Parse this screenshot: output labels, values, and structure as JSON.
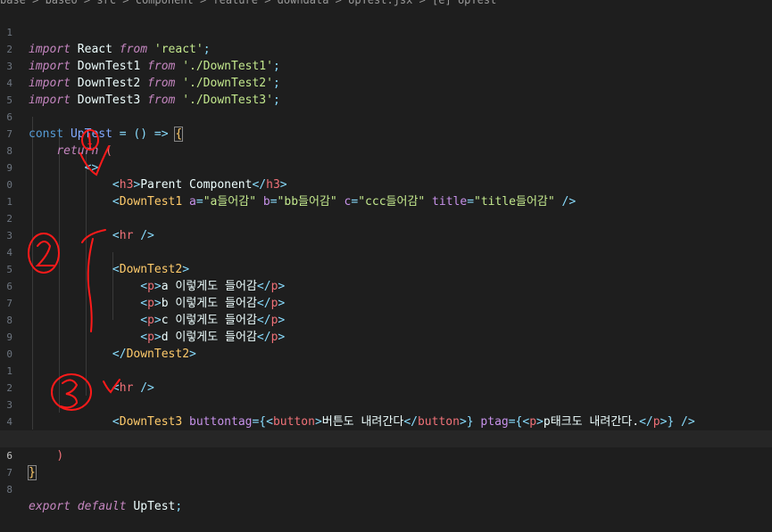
{
  "breadcrumb": "base > baseo > src > component > feature > downdata > UpTest.jsx > [e] UpTest",
  "line_numbers": [
    "1",
    "2",
    "3",
    "4",
    "5",
    "6",
    "7",
    "8",
    "9",
    "0",
    "1",
    "2",
    "3",
    "4",
    "5",
    "6",
    "7",
    "8",
    "9",
    "0",
    "1",
    "2",
    "3",
    "4",
    "5",
    "6",
    "7",
    "8"
  ],
  "code": {
    "l1": {
      "kw": "import",
      "name": " React ",
      "from": "from",
      "space": " ",
      "str": "'react'",
      "end": ";"
    },
    "l2": {
      "kw": "import",
      "name": " DownTest1 ",
      "from": "from",
      "space": " ",
      "str": "'./DownTest1'",
      "end": ";"
    },
    "l3": {
      "kw": "import",
      "name": " DownTest2 ",
      "from": "from",
      "space": " ",
      "str": "'./DownTest2'",
      "end": ";"
    },
    "l4": {
      "kw": "import",
      "name": " DownTest3 ",
      "from": "from",
      "space": " ",
      "str": "'./DownTest3'",
      "end": ";"
    },
    "l6": {
      "const": "const",
      "name": " UpTest",
      "eq": " = () => ",
      "brace": "{"
    },
    "l7": {
      "ret": "return",
      "paren": " ("
    },
    "l8": {
      "frag": "<>"
    },
    "l9": {
      "open": "<",
      "tag": "h3",
      "close": ">",
      "text": "Parent Component",
      "end_open": "</",
      "end_tag": "h3",
      "end_close": ">"
    },
    "l10": {
      "open": "<",
      "comp": "DownTest1",
      "a": " a",
      "eq1": "=",
      "v1": "\"a들어감\"",
      "b": " b",
      "eq2": "=",
      "v2": "\"bb들어감\"",
      "c": " c",
      "eq3": "=",
      "v3": "\"ccc들어감\"",
      "t": " title",
      "eq4": "=",
      "v4": "\"title들어감\"",
      "close": " />"
    },
    "l12": {
      "open": "<",
      "tag": "hr",
      "close": " />"
    },
    "l14": {
      "open": "<",
      "comp": "DownTest2",
      "close": ">"
    },
    "p_lines": [
      {
        "open": "<",
        "tag": "p",
        "close": ">",
        "text": "a 이렇게도 들어감",
        "end_open": "</",
        "end_tag": "p",
        "end_close": ">"
      },
      {
        "open": "<",
        "tag": "p",
        "close": ">",
        "text": "b 이렇게도 들어감",
        "end_open": "</",
        "end_tag": "p",
        "end_close": ">"
      },
      {
        "open": "<",
        "tag": "p",
        "close": ">",
        "text": "c 이렇게도 들어감",
        "end_open": "</",
        "end_tag": "p",
        "end_close": ">"
      },
      {
        "open": "<",
        "tag": "p",
        "close": ">",
        "text": "d 이렇게도 들어감",
        "end_open": "</",
        "end_tag": "p",
        "end_close": ">"
      }
    ],
    "l19": {
      "open": "</",
      "comp": "DownTest2",
      "close": ">"
    },
    "l21": {
      "open": "<",
      "tag": "hr",
      "close": " />"
    },
    "l23": {
      "open": "<",
      "comp": "DownTest3",
      "a1": " buttontag",
      "eq1": "={",
      "bo": "<",
      "bt": "button",
      "bc": ">",
      "btext": "버튼도 내려간다",
      "beo": "</",
      "bet": "button",
      "bec": ">",
      "b_end": "}",
      "a2": " ptag",
      "eq2": "={",
      "po": "<",
      "pt": "p",
      "pc": ">",
      "ptext": "p태크도 내려간다.",
      "peo": "</",
      "pet": "p",
      "pec": ">",
      "p_end": "}",
      "close": " />"
    },
    "l24": {
      "frag": "</>"
    },
    "l25": {
      "paren": ")"
    },
    "l26": {
      "brace": "}"
    },
    "l28": {
      "export": "export",
      "def": " default",
      "name": " UpTest",
      "end": ";"
    }
  },
  "annotations": [
    "1",
    "2",
    "3"
  ],
  "colors": {
    "background": "#1e1e1e",
    "keyword": "#c586c0",
    "string": "#c3e88d",
    "tag": "#f07178",
    "component": "#ffcb6b",
    "attribute": "#c792ea",
    "punctuation": "#89ddff",
    "annotation": "#ff1a1a"
  }
}
